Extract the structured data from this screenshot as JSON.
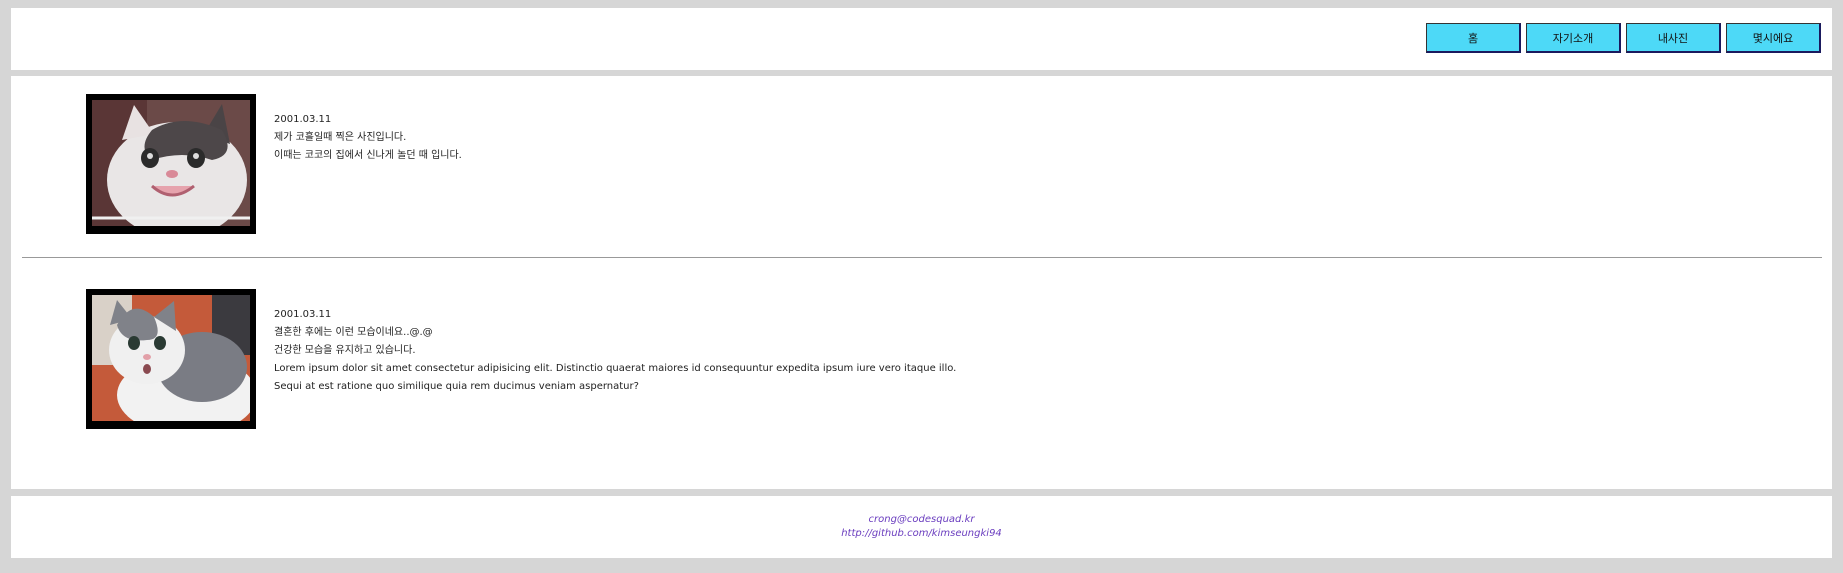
{
  "nav": {
    "items": [
      {
        "label": "홈"
      },
      {
        "label": "자기소개"
      },
      {
        "label": "내사진"
      },
      {
        "label": "몇시에요"
      }
    ]
  },
  "posts": [
    {
      "date": "2001.03.11",
      "lines": [
        "제가 코흘일때 찍은 사진입니다.",
        "이때는 코코의 집에서 신나게 놀던 때 입니다."
      ],
      "image": "cat-photo-smiling"
    },
    {
      "date": "2001.03.11",
      "lines": [
        "결혼한 후에는 이런 모습이네요..@.@",
        "건강한 모습을 유지하고 있습니다.",
        "Lorem ipsum dolor sit amet consectetur adipisicing elit. Distinctio quaerat maiores id consequuntur expedita ipsum iure vero itaque illo.",
        "Sequi at est ratione quo similique quia rem ducimus veniam aspernatur?"
      ],
      "image": "cat-photo-surprised"
    }
  ],
  "footer": {
    "email": "crong@codesquad.kr",
    "github": "http://github.com/kimseungki94"
  },
  "colors": {
    "background": "#d6d6d6",
    "nav_button": "#4dd9f7",
    "footer_link": "#6a3dbf"
  }
}
